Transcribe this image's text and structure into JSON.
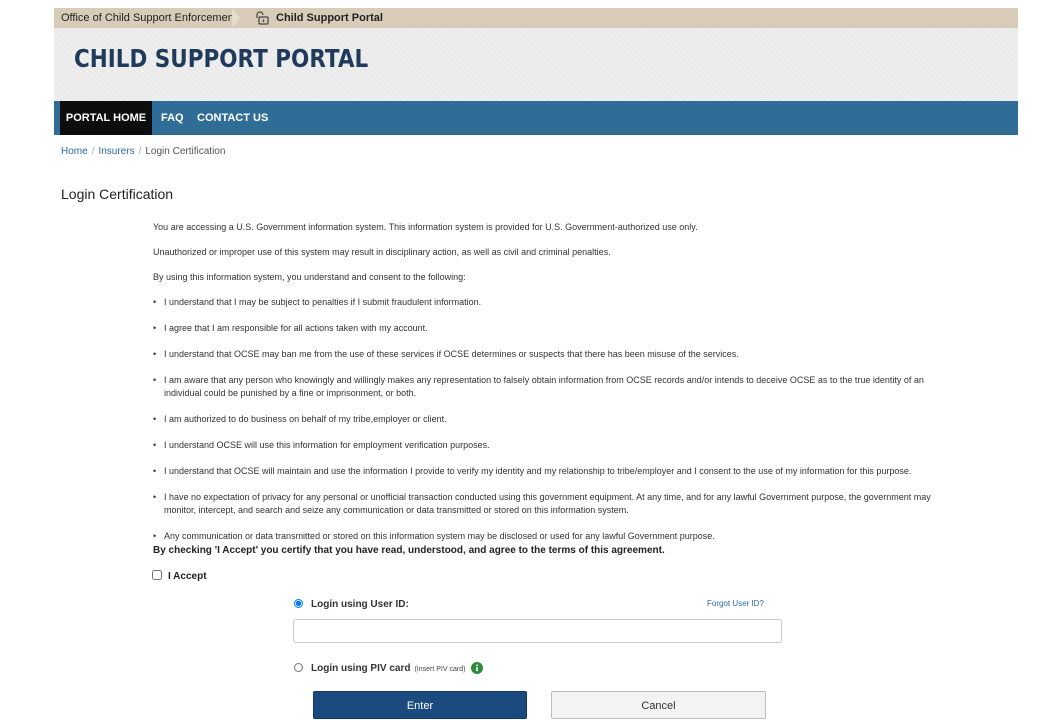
{
  "topbar": {
    "org": "Office of Child Support Enforcement",
    "portal": "Child Support Portal"
  },
  "banner": {
    "title": "CHILD SUPPORT PORTAL"
  },
  "nav": {
    "home": "PORTAL HOME",
    "faq": "FAQ",
    "contact": "CONTACT US"
  },
  "breadcrumb": {
    "home": "Home",
    "insurers": "Insurers",
    "current": "Login Certification",
    "sep": "/"
  },
  "page": {
    "title": "Login Certification"
  },
  "notice": {
    "p1": "You are accessing a U.S. Government information system. This information system is provided for U.S. Government-authorized use only.",
    "p2": "Unauthorized or improper use of this system may result in disciplinary action, as well as civil and criminal penalties.",
    "p3": "By using this information system, you understand and consent to the following:",
    "items": [
      "I understand that I may be subject to penalties if I submit fraudulent information.",
      "I agree that I am responsible for all actions taken with my account.",
      "I understand that OCSE may ban me from the use of these services if OCSE determines or suspects that there has been misuse of the services.",
      "I am aware that any person who knowingly and willingly makes any representation to falsely obtain information from OCSE records and/or intends to deceive OCSE as to the true identity of an individual could be punished by a fine or imprisonment, or both.",
      "I am authorized to do business on behalf of my tribe,employer or client.",
      "I understand OCSE will use this information for employment verification purposes.",
      "I understand that OCSE will maintain and use the information I provide to verify my identity and my relationship to tribe/employer and I consent to the use of my information for this purpose.",
      "I have no expectation of privacy for any personal or unofficial transaction conducted using this government equipment. At any time, and for any lawful Government purpose, the government may monitor, intercept, and search and seize any communication or data transmitted or stored on this information system.",
      "Any communication or data transmitted or stored on this information system may be disclosed or used for any lawful Government purpose."
    ],
    "agreement": "By checking 'I Accept' you certify that you have read, understood, and agree to the terms of this agreement."
  },
  "accept": {
    "label": "I Accept",
    "checked": false
  },
  "login": {
    "userid_label": "Login using User ID:",
    "userid_selected": true,
    "forgot": "Forgot User ID?",
    "userid_value": "",
    "piv_label": "Login using PIV card",
    "piv_hint": "(Insert PIV card)",
    "enter": "Enter",
    "cancel": "Cancel"
  },
  "colors": {
    "nav": "#306d96",
    "nav_active": "#0d0d0d",
    "title": "#1f3a5c",
    "enter_btn": "#1a4a7e",
    "info_icon": "#2e8b3a"
  },
  "icons": {
    "lock": "lock-icon",
    "info": "info-icon"
  }
}
